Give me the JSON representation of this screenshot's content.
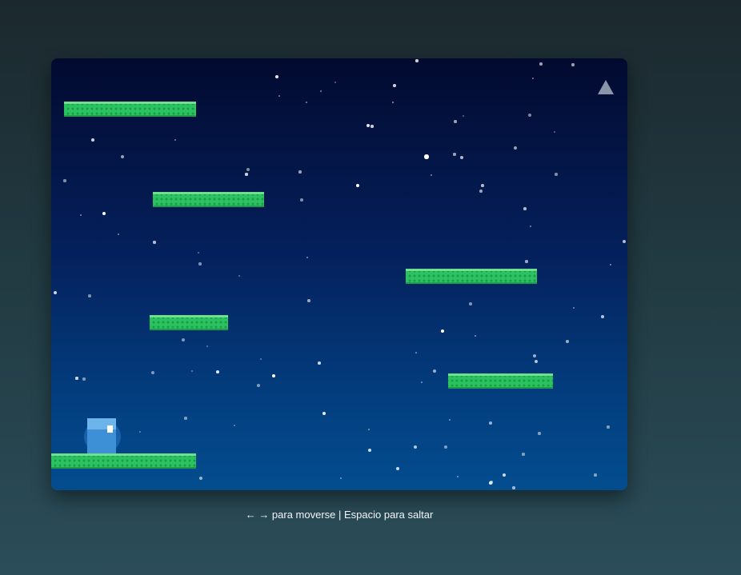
{
  "game": {
    "player": {
      "color": "#3d8fd6",
      "highlight": "#6db4ea"
    },
    "platform_color": "#2bc35f",
    "goal_icon": "triangle-up",
    "background_colors": [
      "#020a2f",
      "#034d8f"
    ]
  },
  "instructions": "← → para moverse | Espacio para saltar"
}
